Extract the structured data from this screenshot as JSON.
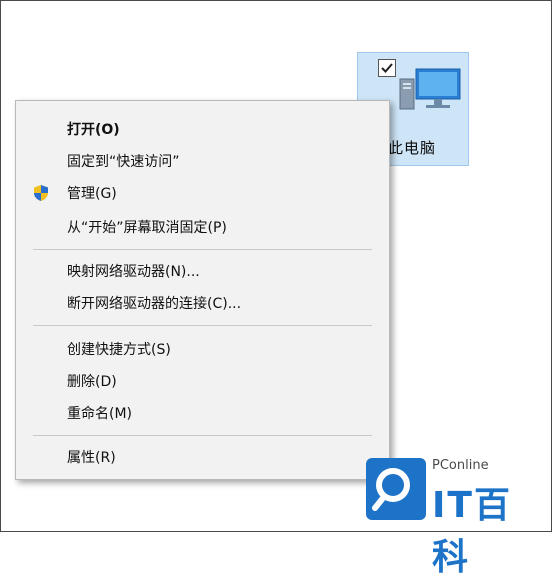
{
  "desktop": {
    "icon_label": "此电脑",
    "checked": true,
    "icon_name": "this-pc-icon"
  },
  "menu": {
    "items": [
      {
        "label": "打开(O)",
        "bold": true
      },
      {
        "label": "固定到“快速访问”"
      },
      {
        "label": "管理(G)",
        "icon": "uac-shield-icon"
      },
      {
        "label": "从“开始”屏幕取消固定(P)"
      },
      {
        "label": "映射网络驱动器(N)..."
      },
      {
        "label": "断开网络驱动器的连接(C)..."
      },
      {
        "label": "创建快捷方式(S)"
      },
      {
        "label": "删除(D)"
      },
      {
        "label": "重命名(M)"
      },
      {
        "label": "属性(R)"
      }
    ]
  },
  "watermark": {
    "site": "PConline",
    "brand": "IT百科"
  },
  "colors": {
    "selection": "#cde5f7",
    "menu_bg": "#f2f2f2",
    "brand_blue": "#1d73c8"
  }
}
